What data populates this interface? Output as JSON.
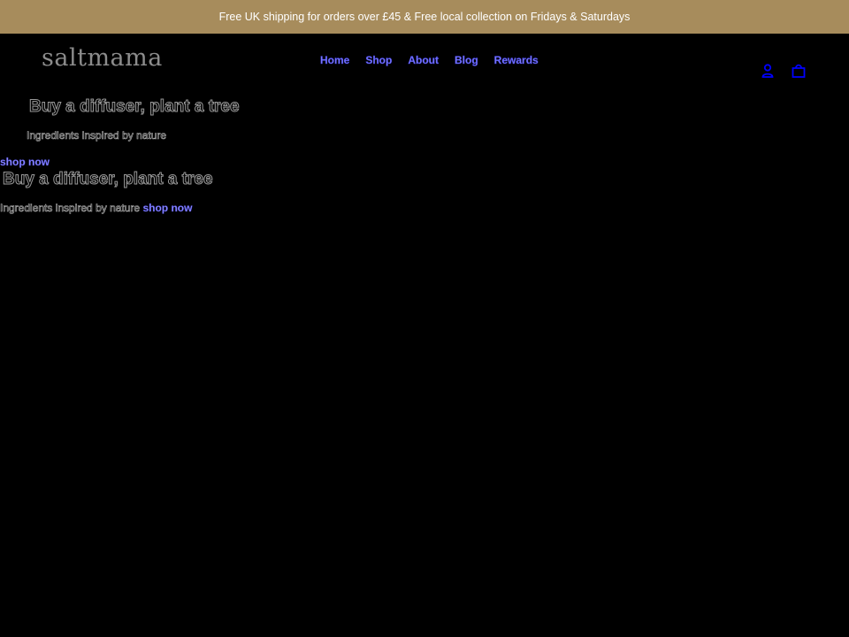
{
  "announcement": {
    "text": "Free UK shipping for orders over £45 & Free local collection on Fridays & Saturdays"
  },
  "header": {
    "logo": "saltmama",
    "nav": [
      {
        "label": "Home"
      },
      {
        "label": "Shop"
      },
      {
        "label": "About"
      },
      {
        "label": "Blog"
      },
      {
        "label": "Rewards"
      }
    ],
    "icons": {
      "account": "user-icon",
      "cart": "bag-icon"
    }
  },
  "hero": {
    "title": "Buy a diffuser, plant a tree",
    "subtitle": "Ingredients inspired by nature",
    "cta": "shop now"
  },
  "hero_repeat": {
    "title": "Buy a diffuser, plant a tree",
    "subtitle": "Ingredients inspired by nature",
    "cta": "shop now"
  },
  "colors": {
    "announcement_bg": "#a78c5c",
    "background": "#000000",
    "link": "#7a78ff",
    "icon": "#0000ff"
  }
}
